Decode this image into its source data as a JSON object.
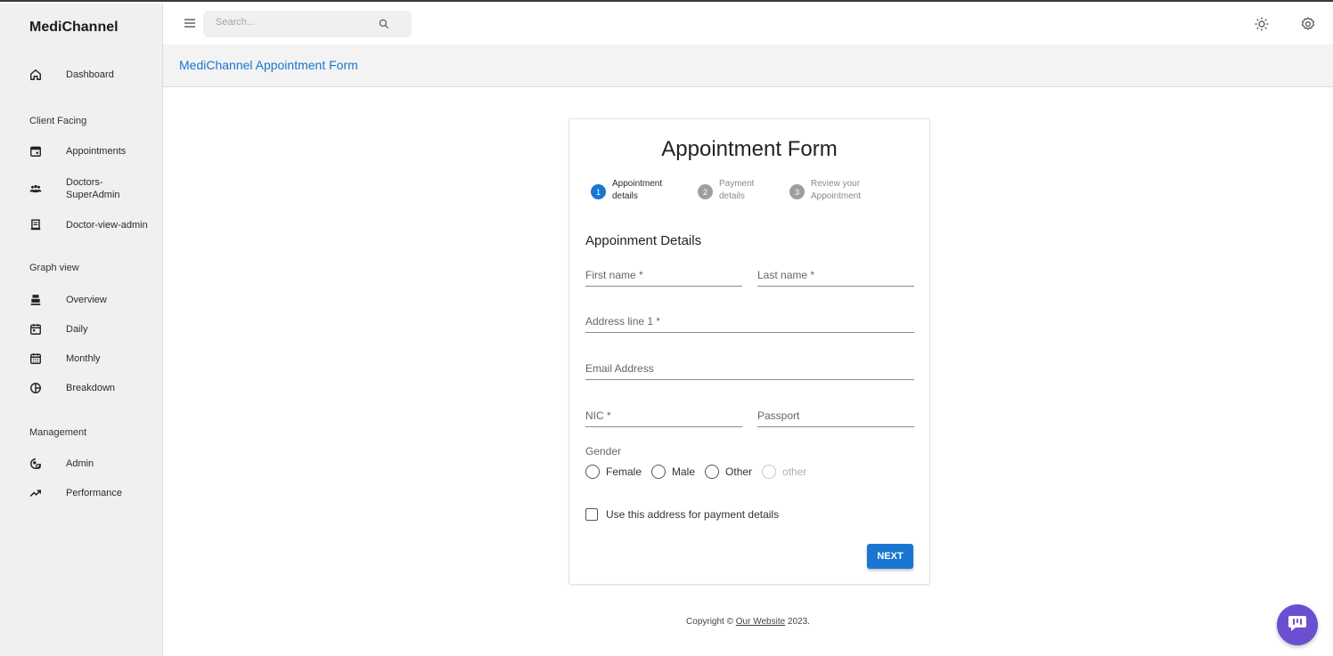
{
  "app": {
    "brand": "MediChannel"
  },
  "sidebar": {
    "dashboard": {
      "label": "Dashboard",
      "icon": "home-icon"
    },
    "sections": {
      "client_facing": "Client Facing",
      "graph_view": "Graph view",
      "management": "Management"
    },
    "items": {
      "appointments": {
        "label": "Appointments",
        "icon": "calendar-icon"
      },
      "doctors_superadmin": {
        "label": "Doctors-SuperAdmin",
        "icon": "people-icon"
      },
      "doctor_view_admin": {
        "label": "Doctor-view-admin",
        "icon": "receipt-icon"
      },
      "overview": {
        "label": "Overview",
        "icon": "point-of-sale-icon"
      },
      "daily": {
        "label": "Daily",
        "icon": "calendar-today-icon"
      },
      "monthly": {
        "label": "Monthly",
        "icon": "calendar-month-icon"
      },
      "breakdown": {
        "label": "Breakdown",
        "icon": "pie-chart-icon"
      },
      "admin": {
        "label": "Admin",
        "icon": "admin-icon"
      },
      "performance": {
        "label": "Performance",
        "icon": "trending-up-icon"
      }
    }
  },
  "topbar": {
    "search_placeholder": "Search...",
    "icons": [
      "menu-icon",
      "search-icon",
      "light-mode-icon",
      "settings-icon"
    ]
  },
  "page": {
    "title": "MediChannel Appointment Form"
  },
  "form": {
    "title": "Appointment Form",
    "steps": [
      {
        "num": "1",
        "label": "Appointment details"
      },
      {
        "num": "2",
        "label": "Payment details"
      },
      {
        "num": "3",
        "label": "Review your Appointment"
      }
    ],
    "section_heading": "Appoinment Details",
    "fields": {
      "first_name": {
        "placeholder": "First name *",
        "value": ""
      },
      "last_name": {
        "placeholder": "Last name *",
        "value": ""
      },
      "address1": {
        "placeholder": "Address line 1 *",
        "value": ""
      },
      "email": {
        "placeholder": "Email Address",
        "value": ""
      },
      "nic": {
        "placeholder": "NIC *",
        "value": ""
      },
      "passport": {
        "placeholder": "Passport",
        "value": ""
      }
    },
    "gender_label": "Gender",
    "gender_options": [
      "Female",
      "Male",
      "Other",
      "other"
    ],
    "checkbox_label": "Use this address for payment details",
    "next_label": "NEXT"
  },
  "footer": {
    "prefix": "Copyright © ",
    "link": "Our Website",
    "suffix": " 2023."
  },
  "colors": {
    "accent": "#1976d2",
    "chat_fab": "#6c4fd0"
  }
}
